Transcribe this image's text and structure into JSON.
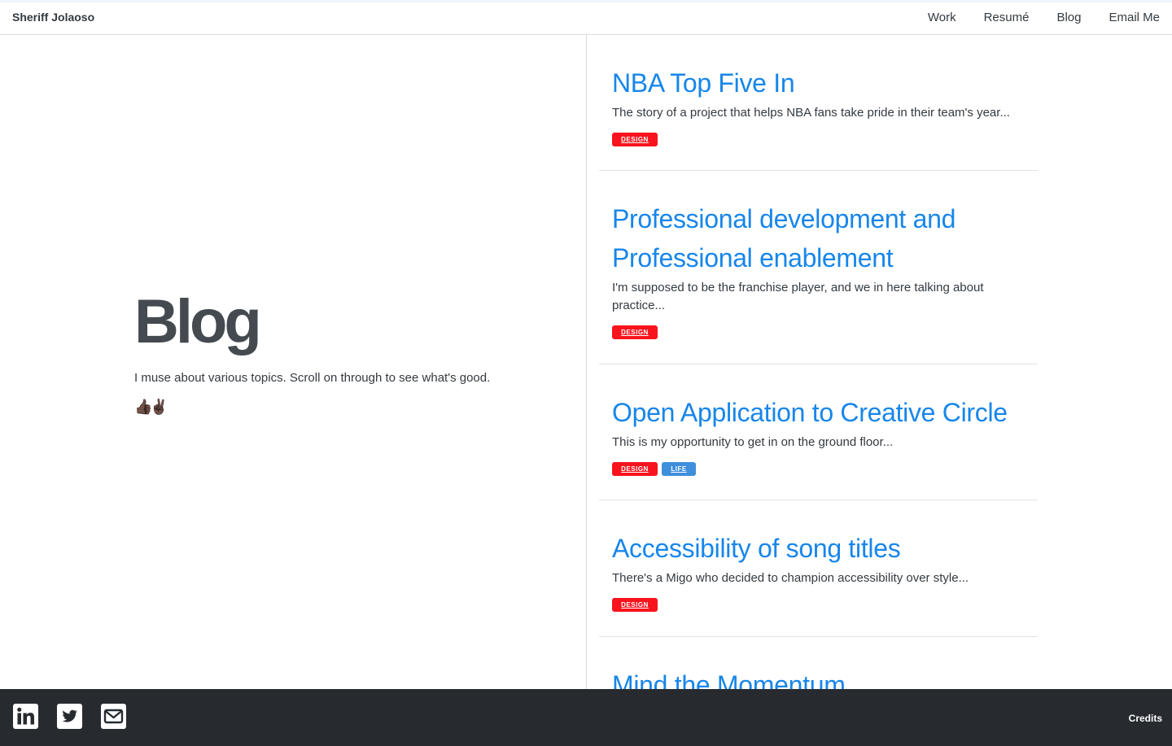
{
  "navbar": {
    "brand": "Sheriff Jolaoso",
    "links": [
      "Work",
      "Resumé",
      "Blog",
      "Email Me"
    ]
  },
  "hero": {
    "title": "Blog",
    "subtitle": "I muse about various topics. Scroll on through to see what's good.",
    "emoji": "👍🏿✌🏿"
  },
  "posts": [
    {
      "title": "NBA Top Five In",
      "excerpt": "The story of a project that helps NBA fans take pride in their team's year...",
      "tags": [
        "DESIGN"
      ]
    },
    {
      "title": "Professional development and Professional enablement",
      "excerpt": "I'm supposed to be the franchise player, and we in here talking about practice...",
      "tags": [
        "DESIGN"
      ]
    },
    {
      "title": "Open Application to Creative Circle",
      "excerpt": "This is my opportunity to get in on the ground floor...",
      "tags": [
        "DESIGN",
        "LIFE"
      ]
    },
    {
      "title": "Accessibility of song titles",
      "excerpt": "There's a Migo who decided to champion accessibility over style...",
      "tags": [
        "DESIGN"
      ]
    },
    {
      "title": "Mind the Momentum",
      "excerpt": "",
      "tags": []
    }
  ],
  "footer": {
    "social_icons": [
      "linkedin-icon",
      "twitter-icon",
      "email-icon"
    ],
    "credits": "Credits"
  },
  "colors": {
    "link": "#1786ea",
    "tag_design": "#f8131d",
    "tag_life": "#3f8fdc",
    "footer_bg": "#272b30"
  }
}
